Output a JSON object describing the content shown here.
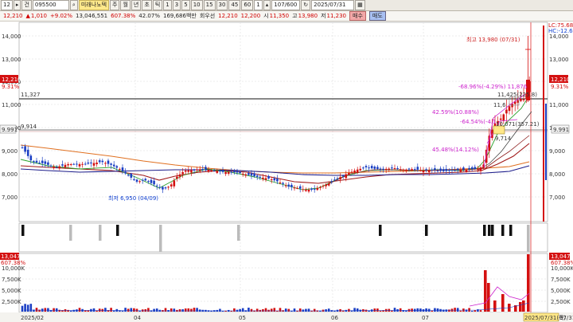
{
  "toolbar": {
    "interval": "12",
    "mode_icon": "arrow-icon",
    "mode_label": "건",
    "stock_code": "095500",
    "search_icon": "search-icon",
    "stock_name": "미래나노텍",
    "periods": [
      "주",
      "월",
      "년",
      "초",
      "틱"
    ],
    "minutes": [
      "1",
      "3",
      "5",
      "10",
      "15",
      "30",
      "45",
      "60",
      "1"
    ],
    "count": "107/600",
    "date": "2025/07/31"
  },
  "quote": {
    "price": "12,210",
    "change": "1,010",
    "change_pct": "+9.02%",
    "volume": "13,046,551",
    "volume_ratio": "607.38%",
    "turnover": "42.07%",
    "amount": "169,686백만",
    "tag": "회우선",
    "bid": "12,210",
    "ask": "12,200",
    "open_label": "시",
    "open": "11,350",
    "high_label": "고",
    "high": "13,980",
    "low_label": "저",
    "low": "11,230",
    "buy_label": "매수",
    "sell_label": "매도"
  },
  "chart": {
    "price_axis": [
      "14,000",
      "13,000",
      "12,000",
      "11,000",
      "10,000",
      "9,000",
      "8,000",
      "7,000"
    ],
    "price_tags": {
      "current": "12,210",
      "current_pct": "9.31%",
      "hline1": "11,327",
      "hline2": "9,914",
      "hline2_right": "9.991",
      "lc": "LC:75.68",
      "hc": "HC:-12.66"
    },
    "annotations": {
      "high": "최고 13,980 (07/31)",
      "low": "최저 6,950 (04/09)",
      "a1": "-68.96%(-4.29%) 11,876",
      "a2": "11,425(225.8)",
      "a3": "42.59%(10.88%)",
      "a4": "-64.54%(-4.1",
      "a5": "10,071(357.21)",
      "a6": "9,714",
      "a7": "45.48%(14.12%)",
      "a8": "11,6"
    },
    "volume_axis": [
      "10,000K",
      "7,500K",
      "5,000K",
      "2,500K"
    ],
    "volume_tags": {
      "current": "13,047K",
      "pct": "607.38%"
    },
    "x_labels": [
      "2025/02",
      "04",
      "05",
      "06",
      "07"
    ],
    "x_current": "2025/07/31(목)",
    "x_right": "07/31"
  },
  "chart_data": {
    "type": "candlestick",
    "x_range": [
      "2025/02",
      "2025/07/31"
    ],
    "price_range": [
      6500,
      14500
    ],
    "high": {
      "value": 13980,
      "date": "07/31"
    },
    "low": {
      "value": 6950,
      "date": "04/09"
    },
    "current": 12210,
    "volume_current_k": 13047
  },
  "colors": {
    "up": "#d41010",
    "down": "#1b3fc4",
    "ma1": "#e07020",
    "ma2": "#a01818",
    "ma3": "#1c1c8a",
    "ma4": "#2aa02a"
  }
}
